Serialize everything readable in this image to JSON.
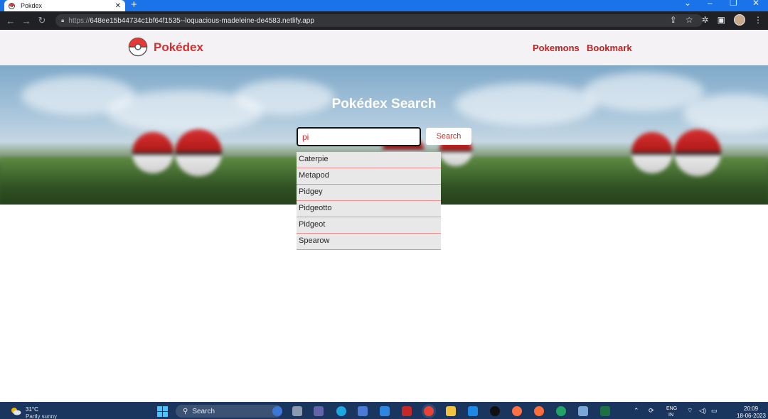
{
  "browser": {
    "tab_title": "Pokdex",
    "tab_close": "✕",
    "new_tab": "+",
    "url_scheme": "https://",
    "url_host": "648ee15b44734c1bf64f1535--loquacious-madeleine-de4583.netlify.app"
  },
  "site": {
    "brand": "Pokédex",
    "nav": [
      "Pokemons",
      "Bookmark"
    ],
    "accent_color": "#d62d2d"
  },
  "hero": {
    "title": "Pokédex Search",
    "search_value": "pi",
    "search_button": "Search"
  },
  "suggestions": [
    "Caterpie",
    "Metapod",
    "Pidgey",
    "Pidgeotto",
    "Pidgeot",
    "Spearow"
  ],
  "taskbar": {
    "weather_temp": "31°C",
    "weather_desc": "Partly sunny",
    "search_label": "Search",
    "lang_primary": "ENG",
    "lang_secondary": "IN",
    "time": "20:09",
    "date": "18-06-2023"
  }
}
